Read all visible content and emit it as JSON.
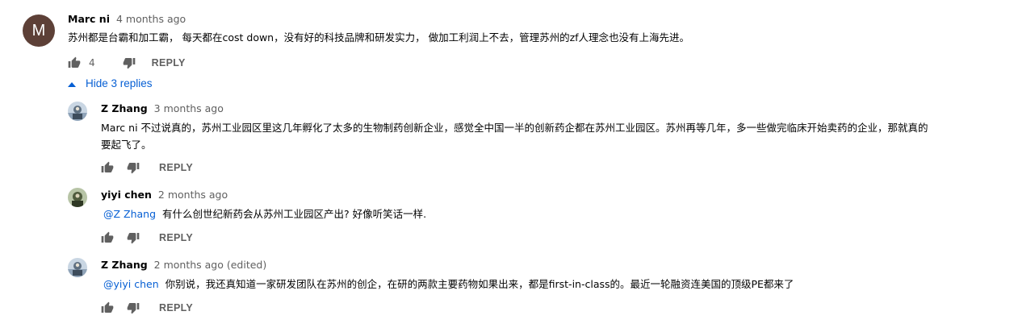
{
  "comment": {
    "avatar_letter": "M",
    "author": "Marc ni",
    "time": "4 months ago",
    "text": "苏州都是台霸和加工霸， 每天都在cost down，没有好的科技品牌和研发实力， 做加工利润上不去，管理苏州的zf人理念也没有上海先进。",
    "likes": "4",
    "reply_label": "REPLY",
    "colors": {
      "avatar_bg": "#5d4037"
    }
  },
  "replies_toggle": {
    "label": "Hide 3 replies",
    "icon": "caret-up-icon"
  },
  "replies": [
    {
      "author": "Z Zhang",
      "time": "3 months ago",
      "text_line1": "Marc ni 不过说真的，苏州工业园区里这几年孵化了太多的生物制药创新企业，感觉全中国一半的创新药企都在苏州工业园区。苏州再等几年，多一些做完临床开始卖药的企业，那就真的",
      "text_line2": "要起飞了。",
      "reply_label": "REPLY"
    },
    {
      "author": "yiyi chen",
      "time": "2 months ago",
      "mention": "@Z Zhang",
      "text": "有什么创世纪新药会从苏州工业园区产出? 好像听笑话一样.",
      "reply_label": "REPLY"
    },
    {
      "author": "Z Zhang",
      "time": "2 months ago (edited)",
      "mention": "@yiyi chen",
      "text": "你别说，我还真知道一家研发团队在苏州的创企，在研的两款主要药物如果出来，都是first-in-class的。最近一轮融资连美国的顶级PE都来了",
      "reply_label": "REPLY"
    }
  ]
}
